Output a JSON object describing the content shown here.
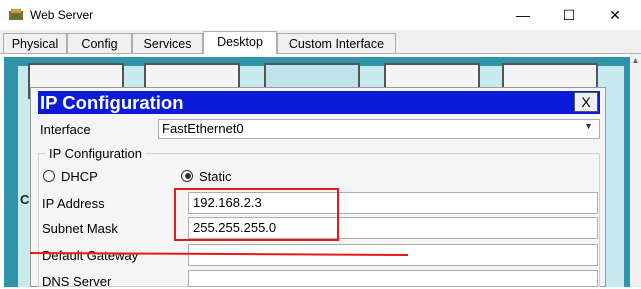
{
  "window": {
    "title": "Web Server",
    "minimize_glyph": "—",
    "maximize_glyph": "☐",
    "close_glyph": "✕"
  },
  "tabs": [
    {
      "label": "Physical"
    },
    {
      "label": "Config"
    },
    {
      "label": "Services"
    },
    {
      "label": "Desktop",
      "active": true
    },
    {
      "label": "Custom Interface"
    }
  ],
  "dialog": {
    "title": "IP Configuration",
    "close_label": "X",
    "interface_label": "Interface",
    "interface_value": "FastEthernet0",
    "group_title": "IP Configuration",
    "dhcp_label": "DHCP",
    "static_label": "Static",
    "mode": "Static",
    "fields": [
      {
        "label": "IP Address",
        "value": "192.168.2.3"
      },
      {
        "label": "Subnet Mask",
        "value": "255.255.255.0"
      },
      {
        "label": "Default Gateway",
        "value": ""
      },
      {
        "label": "DNS Server",
        "value": ""
      }
    ]
  },
  "annotation": {
    "color": "#e8191b"
  },
  "colors": {
    "dialog_header": "#0b1bd9",
    "desktop_bg": "#2f93a9"
  }
}
